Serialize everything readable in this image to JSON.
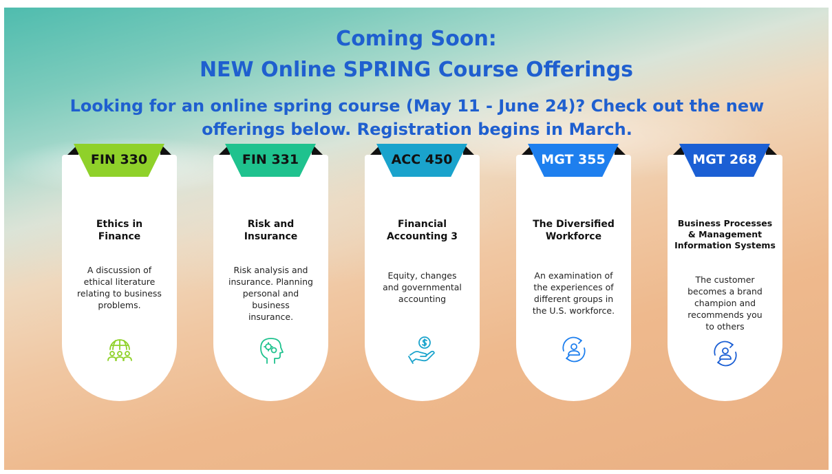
{
  "header": {
    "line1": "Coming Soon:",
    "line2": "NEW Online SPRING Course Offerings",
    "subtitle": "Looking for an online spring course (May 11 - June 24)?  Check out the new offerings below. Registration begins in March."
  },
  "colors": {
    "heading": "#1f5fcf"
  },
  "courses": [
    {
      "code": "FIN 330",
      "title": "Ethics in Finance",
      "description": "A discussion of ethical literature relating to business problems.",
      "icon": "globe-people-icon",
      "color": "#8fd12a",
      "code_color": "#111111"
    },
    {
      "code": "FIN 331",
      "title": "Risk and Insurance",
      "description": "Risk analysis and insurance. Planning personal and business insurance.",
      "icon": "head-gears-icon",
      "color": "#1fc28e",
      "code_color": "#111111"
    },
    {
      "code": "ACC 450",
      "title": "Financial Accounting 3",
      "description": "Equity, changes and governmental accounting",
      "icon": "hand-coin-icon",
      "color": "#1aa3cc",
      "code_color": "#111111"
    },
    {
      "code": "MGT 355",
      "title": "The Diversified Workforce",
      "description": "An examination of the experiences of different groups in the U.S. workforce.",
      "icon": "person-cycle-icon",
      "color": "#1e7fee",
      "code_color": "#ffffff"
    },
    {
      "code": "MGT 268",
      "title": "Business Processes & Management Information Systems",
      "description": "The customer becomes a brand champion and recommends you to others",
      "icon": "person-cycle-icon",
      "color": "#1b5fd4",
      "code_color": "#ffffff"
    }
  ]
}
